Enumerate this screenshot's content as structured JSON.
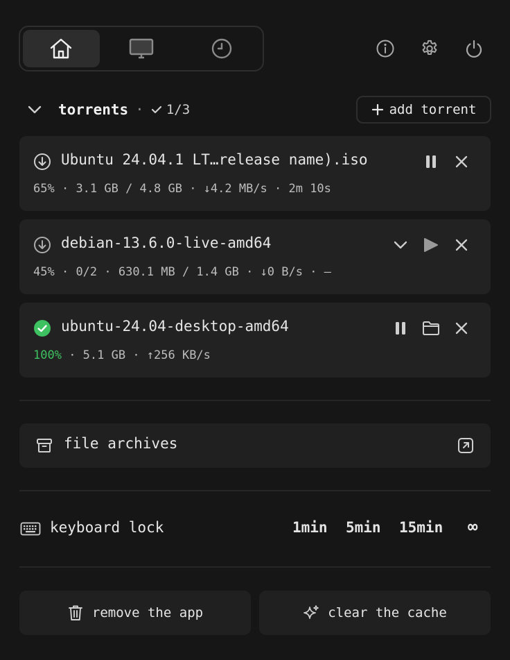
{
  "topbar": {
    "tabs": [
      {
        "icon": "home-icon",
        "active": true
      },
      {
        "icon": "monitor-icon",
        "active": false
      },
      {
        "icon": "clock-icon",
        "active": false
      }
    ],
    "actions": [
      "info-icon",
      "gear-icon",
      "power-icon"
    ]
  },
  "torrents_section": {
    "title": "torrents",
    "separator": "·",
    "completed_count": "1/3",
    "add_label": "add torrent"
  },
  "torrents": [
    {
      "name": "Ubuntu 24.04.1 LT…release name).iso",
      "status_icon": "download-circle-icon",
      "percent": "65%",
      "meta": "· 3.1 GB / 4.8 GB · ↓4.2 MB/s · 2m 10s",
      "actions": [
        "pause-icon",
        "close-icon"
      ]
    },
    {
      "name": "debian-13.6.0-live-amd64",
      "status_icon": "download-circle-icon",
      "percent": "45%",
      "meta": "· 0/2 · 630.1 MB / 1.4 GB · ↓0 B/s · —",
      "actions": [
        "chevron-down-icon",
        "play-icon",
        "close-icon"
      ]
    },
    {
      "name": "ubuntu-24.04-desktop-amd64",
      "status_icon": "check-circle-icon",
      "percent": "100%",
      "meta": "· 5.1 GB · ↑256 KB/s",
      "actions": [
        "pause-icon",
        "folder-icon",
        "close-icon"
      ]
    }
  ],
  "archives": {
    "label": "file archives"
  },
  "keyboard_lock": {
    "label": "keyboard lock",
    "options": [
      "1min",
      "5min",
      "15min",
      "∞"
    ]
  },
  "bottom_buttons": {
    "remove": "remove the app",
    "clear": "clear the cache"
  },
  "colors": {
    "background": "#161616",
    "card": "#222222",
    "success": "#3ec160"
  }
}
